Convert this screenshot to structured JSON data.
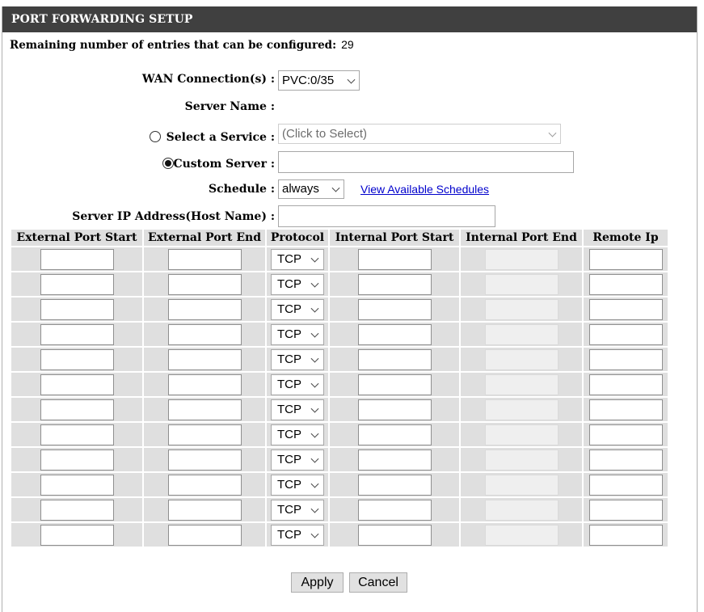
{
  "header": {
    "title": "PORT FORWARDING SETUP"
  },
  "remaining": {
    "label": "Remaining number of entries that can be configured:",
    "value": "29"
  },
  "form": {
    "wan_label": "WAN Connection(s) :",
    "wan_value": "PVC:0/35",
    "server_name_label": "Server Name :",
    "select_service_label": "Select a Service :",
    "select_service_placeholder": "(Click to Select)",
    "custom_server_label": "Custom Server :",
    "custom_server_value": "",
    "schedule_label": "Schedule :",
    "schedule_value": "always",
    "schedule_link": "View Available Schedules",
    "server_ip_label": "Server IP Address(Host Name) :",
    "server_ip_value": ""
  },
  "table": {
    "columns": [
      "External Port Start",
      "External Port End",
      "Protocol",
      "Internal Port Start",
      "Internal Port End",
      "Remote Ip"
    ],
    "protocol_default": "TCP",
    "rows": 12
  },
  "buttons": {
    "apply": "Apply",
    "cancel": "Cancel"
  }
}
